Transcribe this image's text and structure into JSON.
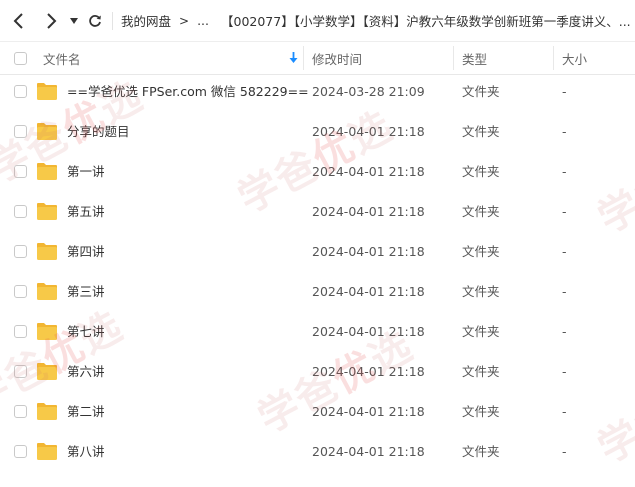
{
  "nav": {
    "back_icon": "chevron-left-icon",
    "forward_icon": "chevron-right-icon",
    "dropdown_icon": "caret-down-icon",
    "refresh_icon": "refresh-icon"
  },
  "breadcrumb": {
    "items": [
      "我的网盘",
      "...",
      "【002077】【小学数学】【资料】沪教六年级数学创新班第一季度讲义、..."
    ],
    "separator": ">"
  },
  "columns": {
    "name": "文件名",
    "sort_icon": "arrow-down-icon",
    "modified": "修改时间",
    "type": "类型",
    "size": "大小"
  },
  "files": [
    {
      "name": "==学爸优选 FPSer.com 微信 582229==",
      "modified": "2024-03-28 21:09",
      "type": "文件夹",
      "size": "-"
    },
    {
      "name": "分享的题目",
      "modified": "2024-04-01 21:18",
      "type": "文件夹",
      "size": "-"
    },
    {
      "name": "第一讲",
      "modified": "2024-04-01 21:18",
      "type": "文件夹",
      "size": "-"
    },
    {
      "name": "第五讲",
      "modified": "2024-04-01 21:18",
      "type": "文件夹",
      "size": "-"
    },
    {
      "name": "第四讲",
      "modified": "2024-04-01 21:18",
      "type": "文件夹",
      "size": "-"
    },
    {
      "name": "第三讲",
      "modified": "2024-04-01 21:18",
      "type": "文件夹",
      "size": "-"
    },
    {
      "name": "第七讲",
      "modified": "2024-04-01 21:18",
      "type": "文件夹",
      "size": "-"
    },
    {
      "name": "第六讲",
      "modified": "2024-04-01 21:18",
      "type": "文件夹",
      "size": "-"
    },
    {
      "name": "第二讲",
      "modified": "2024-04-01 21:18",
      "type": "文件夹",
      "size": "-"
    },
    {
      "name": "第八讲",
      "modified": "2024-04-01 21:18",
      "type": "文件夹",
      "size": "-"
    }
  ],
  "watermark": {
    "parts": [
      "学爸",
      "优",
      "选"
    ]
  },
  "colors": {
    "folder": "#f7c948",
    "folder_tab": "#f2b632",
    "sort_arrow": "#1a8cff",
    "watermark": "#e05a5a"
  }
}
